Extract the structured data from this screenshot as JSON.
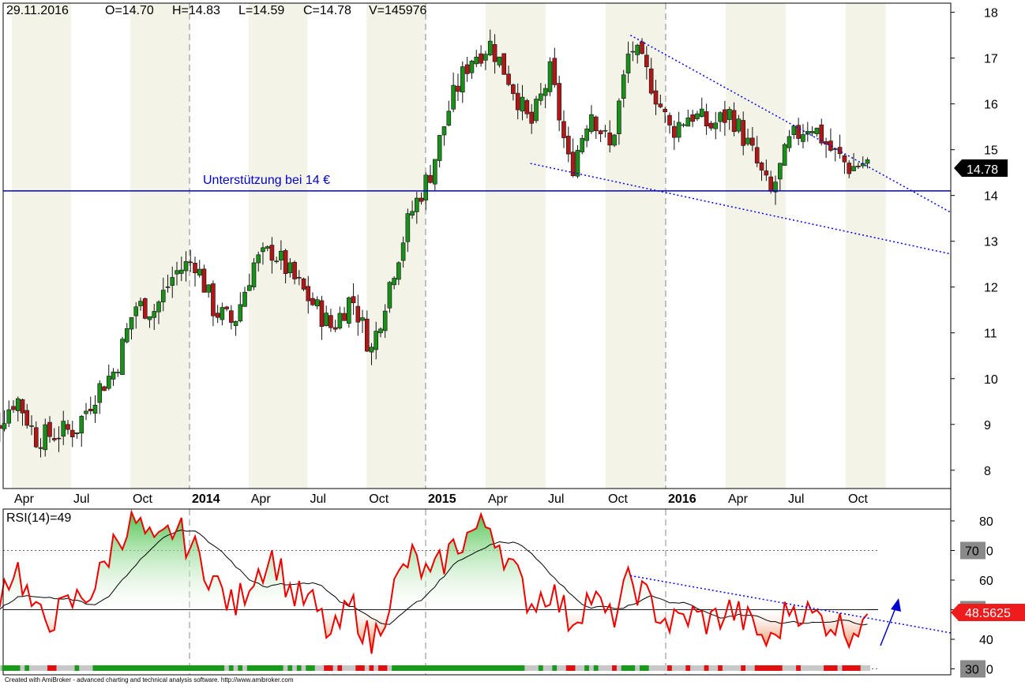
{
  "header": {
    "date": "29.11.2016",
    "open": "O=14.70",
    "high": "H=14.83",
    "low": "L=14.59",
    "close": "C=14.78",
    "volume": "V=145976"
  },
  "annotation_support": "Unterstützung bei 14 €",
  "price_tag": "14.78",
  "rsi_title": "RSI(14)=49",
  "rsi_tag": "48.5625",
  "rsi_level_boxes": [
    "70",
    "50",
    "30"
  ],
  "footer": "Created with AmiBroker - advanced charting and technical analysis software. http://www.amibroker.com",
  "x_labels": [
    {
      "t": "Apr",
      "w": false
    },
    {
      "t": "Jul",
      "w": false
    },
    {
      "t": "Oct",
      "w": false
    },
    {
      "t": "2014",
      "w": true
    },
    {
      "t": "Apr",
      "w": false
    },
    {
      "t": "Jul",
      "w": false
    },
    {
      "t": "Oct",
      "w": false
    },
    {
      "t": "2015",
      "w": true
    },
    {
      "t": "Apr",
      "w": false
    },
    {
      "t": "Jul",
      "w": false
    },
    {
      "t": "Oct",
      "w": false
    },
    {
      "t": "2016",
      "w": true
    },
    {
      "t": "Apr",
      "w": false
    },
    {
      "t": "Jul",
      "w": false
    },
    {
      "t": "Oct",
      "w": false
    }
  ],
  "colors": {
    "up": "#1a8f1a",
    "down": "#b01818",
    "support": "#0000cc",
    "trend": "#0000ee",
    "rsi": "#ee0000",
    "rsi_ma": "#000000",
    "tag_bg": "#000000",
    "tag_red": "#ee1c1c"
  },
  "chart_data": [
    {
      "type": "candlestick",
      "title": "",
      "period": "weekly",
      "x_range": [
        "2013-02",
        "2016-11"
      ],
      "ylim": [
        7.6,
        18.2
      ],
      "y_ticks": [
        8,
        9,
        10,
        11,
        12,
        13,
        14,
        15,
        16,
        17,
        18
      ],
      "support_level": 14.1,
      "last": {
        "date": "29.11.2016",
        "open": 14.7,
        "high": 14.83,
        "low": 14.59,
        "close": 14.78,
        "volume": 145976
      },
      "close_anchors": [
        [
          "2013-02",
          8.4
        ],
        [
          "2013-04",
          9.6
        ],
        [
          "2013-05",
          8.7
        ],
        [
          "2013-07",
          8.9
        ],
        [
          "2013-08",
          9.7
        ],
        [
          "2013-09",
          10.2
        ],
        [
          "2013-10",
          11.6
        ],
        [
          "2013-11",
          11.5
        ],
        [
          "2013-12",
          12.3
        ],
        [
          "2014-01",
          12.6
        ],
        [
          "2014-02",
          11.5
        ],
        [
          "2014-03",
          11.2
        ],
        [
          "2014-04",
          12.5
        ],
        [
          "2014-05",
          12.8
        ],
        [
          "2014-06",
          12.2
        ],
        [
          "2014-08",
          11.1
        ],
        [
          "2014-09",
          11.8
        ],
        [
          "2014-10",
          10.6
        ],
        [
          "2014-11",
          12.2
        ],
        [
          "2014-12",
          13.6
        ],
        [
          "2015-01",
          14.5
        ],
        [
          "2015-02",
          16.0
        ],
        [
          "2015-03",
          17.0
        ],
        [
          "2015-04",
          17.3
        ],
        [
          "2015-05",
          16.5
        ],
        [
          "2015-06",
          15.5
        ],
        [
          "2015-07",
          16.7
        ],
        [
          "2015-08",
          14.5
        ],
        [
          "2015-09",
          15.9
        ],
        [
          "2015-10",
          15.0
        ],
        [
          "2015-11",
          17.3
        ],
        [
          "2015-12",
          16.5
        ],
        [
          "2016-01",
          15.4
        ],
        [
          "2016-02",
          15.8
        ],
        [
          "2016-03",
          15.5
        ],
        [
          "2016-04",
          15.8
        ],
        [
          "2016-05",
          15.0
        ],
        [
          "2016-06",
          14.0
        ],
        [
          "2016-07",
          15.2
        ],
        [
          "2016-08",
          15.6
        ],
        [
          "2016-09",
          15.0
        ],
        [
          "2016-10",
          14.6
        ],
        [
          "2016-11",
          14.78
        ]
      ],
      "trendline_upper": [
        [
          "2015-11",
          17.5
        ],
        [
          "2016-11",
          14.6
        ]
      ],
      "trendline_lower": [
        [
          "2015-06",
          14.7
        ],
        [
          "2016-11",
          13.1
        ]
      ]
    },
    {
      "type": "line",
      "title": "RSI(14)",
      "ylim": [
        28,
        84
      ],
      "y_ticks": [
        30,
        40,
        50,
        60,
        70,
        80
      ],
      "levels": [
        70,
        50,
        30
      ],
      "last_value": 48.5625,
      "rsi_anchors": [
        [
          "2013-02",
          43
        ],
        [
          "2013-03",
          55
        ],
        [
          "2013-04",
          65
        ],
        [
          "2013-05",
          47
        ],
        [
          "2013-06",
          48
        ],
        [
          "2013-07",
          53
        ],
        [
          "2013-08",
          58
        ],
        [
          "2013-09",
          74
        ],
        [
          "2013-10",
          80
        ],
        [
          "2013-11",
          70
        ],
        [
          "2013-12",
          78
        ],
        [
          "2014-01",
          70
        ],
        [
          "2014-02",
          60
        ],
        [
          "2014-03",
          50
        ],
        [
          "2014-04",
          62
        ],
        [
          "2014-05",
          68
        ],
        [
          "2014-06",
          55
        ],
        [
          "2014-07",
          52
        ],
        [
          "2014-08",
          40
        ],
        [
          "2014-09",
          52
        ],
        [
          "2014-10",
          38
        ],
        [
          "2014-11",
          55
        ],
        [
          "2014-12",
          68
        ],
        [
          "2015-01",
          60
        ],
        [
          "2015-02",
          70
        ],
        [
          "2015-03",
          76
        ],
        [
          "2015-04",
          79
        ],
        [
          "2015-05",
          65
        ],
        [
          "2015-06",
          52
        ],
        [
          "2015-07",
          57
        ],
        [
          "2015-08",
          46
        ],
        [
          "2015-09",
          55
        ],
        [
          "2015-10",
          46
        ],
        [
          "2015-11",
          60
        ],
        [
          "2015-12",
          52
        ],
        [
          "2016-01",
          45
        ],
        [
          "2016-02",
          48
        ],
        [
          "2016-03",
          46
        ],
        [
          "2016-04",
          50
        ],
        [
          "2016-05",
          45
        ],
        [
          "2016-06",
          38
        ],
        [
          "2016-07",
          52
        ],
        [
          "2016-08",
          48
        ],
        [
          "2016-09",
          46
        ],
        [
          "2016-10",
          43
        ],
        [
          "2016-11",
          48.56
        ]
      ],
      "trendline": [
        [
          "2015-11",
          61.5
        ],
        [
          "2016-11",
          47
        ]
      ],
      "band_colors_order": [
        "red",
        "grey",
        "green"
      ]
    }
  ]
}
